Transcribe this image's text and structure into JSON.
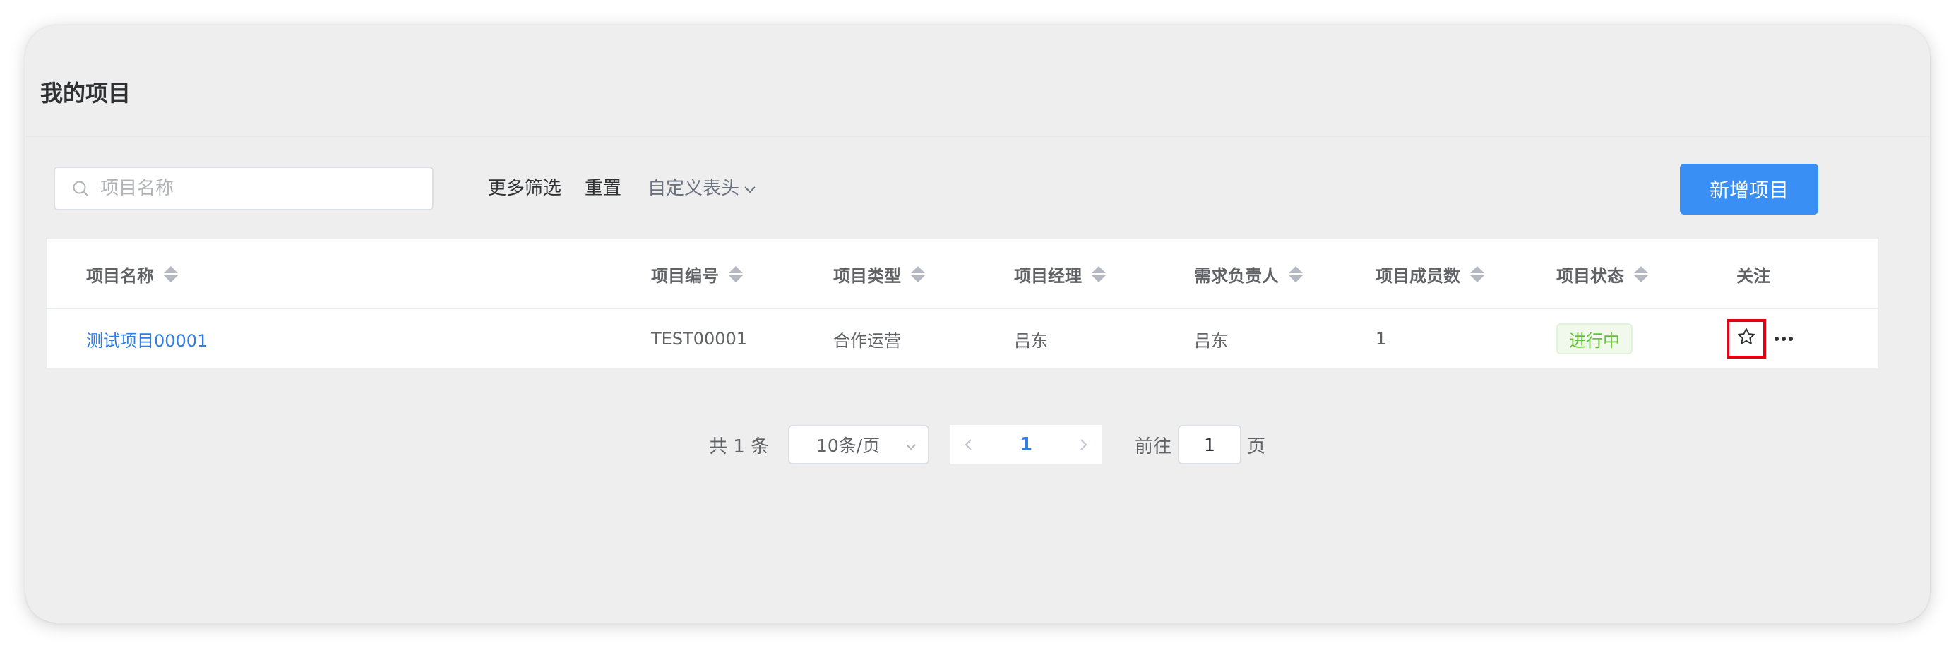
{
  "page": {
    "title": "我的项目"
  },
  "toolbar": {
    "search_placeholder": "项目名称",
    "more_filters": "更多筛选",
    "reset": "重置",
    "custom_header": "自定义表头",
    "new_project": "新增项目"
  },
  "table": {
    "columns": [
      {
        "label": "项目名称",
        "sortable": true
      },
      {
        "label": "项目编号",
        "sortable": true
      },
      {
        "label": "项目类型",
        "sortable": true
      },
      {
        "label": "项目经理",
        "sortable": true
      },
      {
        "label": "需求负责人",
        "sortable": true
      },
      {
        "label": "项目成员数",
        "sortable": true
      },
      {
        "label": "项目状态",
        "sortable": true
      },
      {
        "label": "关注",
        "sortable": false
      }
    ],
    "rows": [
      {
        "name": "测试项目00001",
        "code": "TEST00001",
        "type": "合作运营",
        "manager": "吕东",
        "requirement_owner": "吕东",
        "member_count": "1",
        "status": "进行中",
        "follow_icon": "star-outline-icon",
        "more_icon": "more-horizontal-icon"
      }
    ]
  },
  "pagination": {
    "total": "共 1 条",
    "page_size": "10条/页",
    "current_page": "1",
    "goto_label": "前往",
    "goto_value": "1",
    "page_suffix": "页"
  },
  "colors": {
    "primary": "#3a8ff5",
    "link": "#2f7ee8",
    "status_green": "#67c23a",
    "highlight_border": "#e60012"
  }
}
